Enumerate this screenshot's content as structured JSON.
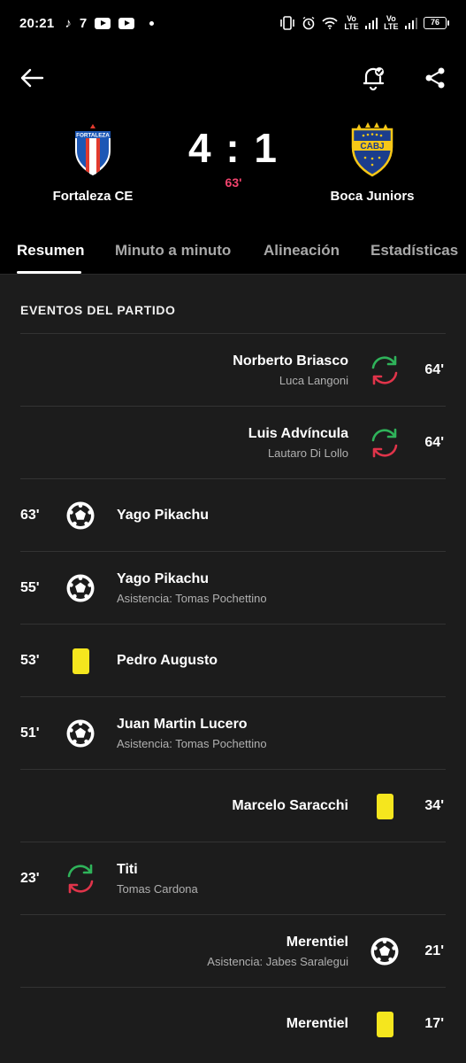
{
  "status_bar": {
    "time": "20:21",
    "app_icons": [
      "tiktok-icon",
      "seven-icon",
      "youtube-icon",
      "youtube-icon"
    ],
    "volte1": "Vo\nLTE",
    "volte2": "Vo\nLTE",
    "battery": "76"
  },
  "header": {
    "home_team": {
      "name": "Fortaleza CE",
      "crest_text": "FORTALEZA"
    },
    "away_team": {
      "name": "Boca Juniors",
      "crest_text": "CABJ"
    },
    "score": "4 : 1",
    "minute": "63'",
    "colors": {
      "minute": "#f2446e",
      "background": "#000000"
    }
  },
  "tabs": [
    {
      "label": "Resumen",
      "active": true
    },
    {
      "label": "Minuto a minuto",
      "active": false
    },
    {
      "label": "Alineación",
      "active": false
    },
    {
      "label": "Estadísticas",
      "active": false
    }
  ],
  "section_title": "EVENTOS DEL PARTIDO",
  "events": [
    {
      "side": "away",
      "type": "substitution",
      "minute": "64'",
      "main": "Norberto Briasco",
      "sub": "Luca Langoni"
    },
    {
      "side": "away",
      "type": "substitution",
      "minute": "64'",
      "main": "Luis Advíncula",
      "sub": "Lautaro Di Lollo"
    },
    {
      "side": "home",
      "type": "goal",
      "minute": "63'",
      "main": "Yago Pikachu",
      "sub": ""
    },
    {
      "side": "home",
      "type": "goal",
      "minute": "55'",
      "main": "Yago Pikachu",
      "sub": "Asistencia: Tomas Pochettino"
    },
    {
      "side": "home",
      "type": "yellow-card",
      "minute": "53'",
      "main": "Pedro Augusto",
      "sub": ""
    },
    {
      "side": "home",
      "type": "goal",
      "minute": "51'",
      "main": "Juan Martin Lucero",
      "sub": "Asistencia: Tomas Pochettino"
    },
    {
      "side": "away",
      "type": "yellow-card",
      "minute": "34'",
      "main": "Marcelo Saracchi",
      "sub": ""
    },
    {
      "side": "home",
      "type": "substitution",
      "minute": "23'",
      "main": "Titi",
      "sub": "Tomas Cardona"
    },
    {
      "side": "away",
      "type": "goal",
      "minute": "21'",
      "main": "Merentiel",
      "sub": "Asistencia: Jabes Saralegui"
    },
    {
      "side": "away",
      "type": "yellow-card",
      "minute": "17'",
      "main": "Merentiel",
      "sub": ""
    }
  ]
}
